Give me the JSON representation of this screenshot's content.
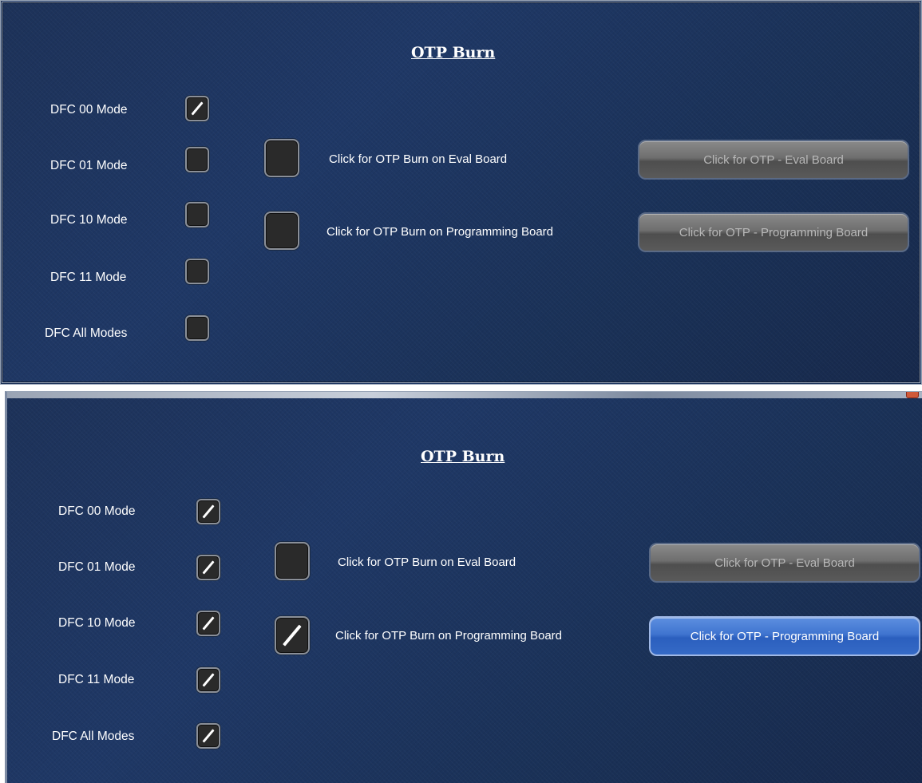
{
  "screens": [
    {
      "title": "OTP Burn",
      "modes": [
        {
          "label": "DFC 00 Mode",
          "checked": true
        },
        {
          "label": "DFC 01 Mode",
          "checked": false
        },
        {
          "label": "DFC 10 Mode",
          "checked": false
        },
        {
          "label": "DFC 11 Mode",
          "checked": false
        },
        {
          "label": "DFC All Modes",
          "checked": false
        }
      ],
      "otp_options": [
        {
          "label": "Click for OTP Burn on Eval Board",
          "checked": false,
          "button_label": "Click for OTP - Eval Board",
          "button_enabled": false
        },
        {
          "label": "Click for OTP Burn on Programming Board",
          "checked": false,
          "button_label": "Click for OTP - Programming Board",
          "button_enabled": false
        }
      ]
    },
    {
      "title": "OTP Burn",
      "modes": [
        {
          "label": "DFC 00 Mode",
          "checked": true
        },
        {
          "label": "DFC 01 Mode",
          "checked": true
        },
        {
          "label": "DFC 10 Mode",
          "checked": true
        },
        {
          "label": "DFC 11 Mode",
          "checked": true
        },
        {
          "label": "DFC All Modes",
          "checked": true
        }
      ],
      "otp_options": [
        {
          "label": "Click for OTP Burn on Eval Board",
          "checked": false,
          "button_label": "Click for OTP - Eval Board",
          "button_enabled": false
        },
        {
          "label": "Click for OTP Burn on Programming Board",
          "checked": true,
          "button_label": "Click for OTP - Programming Board",
          "button_enabled": true
        }
      ],
      "colors": {
        "enabled_button": "#3f74cf",
        "disabled_button": "#6e6e6e",
        "panel_background": "#1f3866"
      }
    }
  ]
}
